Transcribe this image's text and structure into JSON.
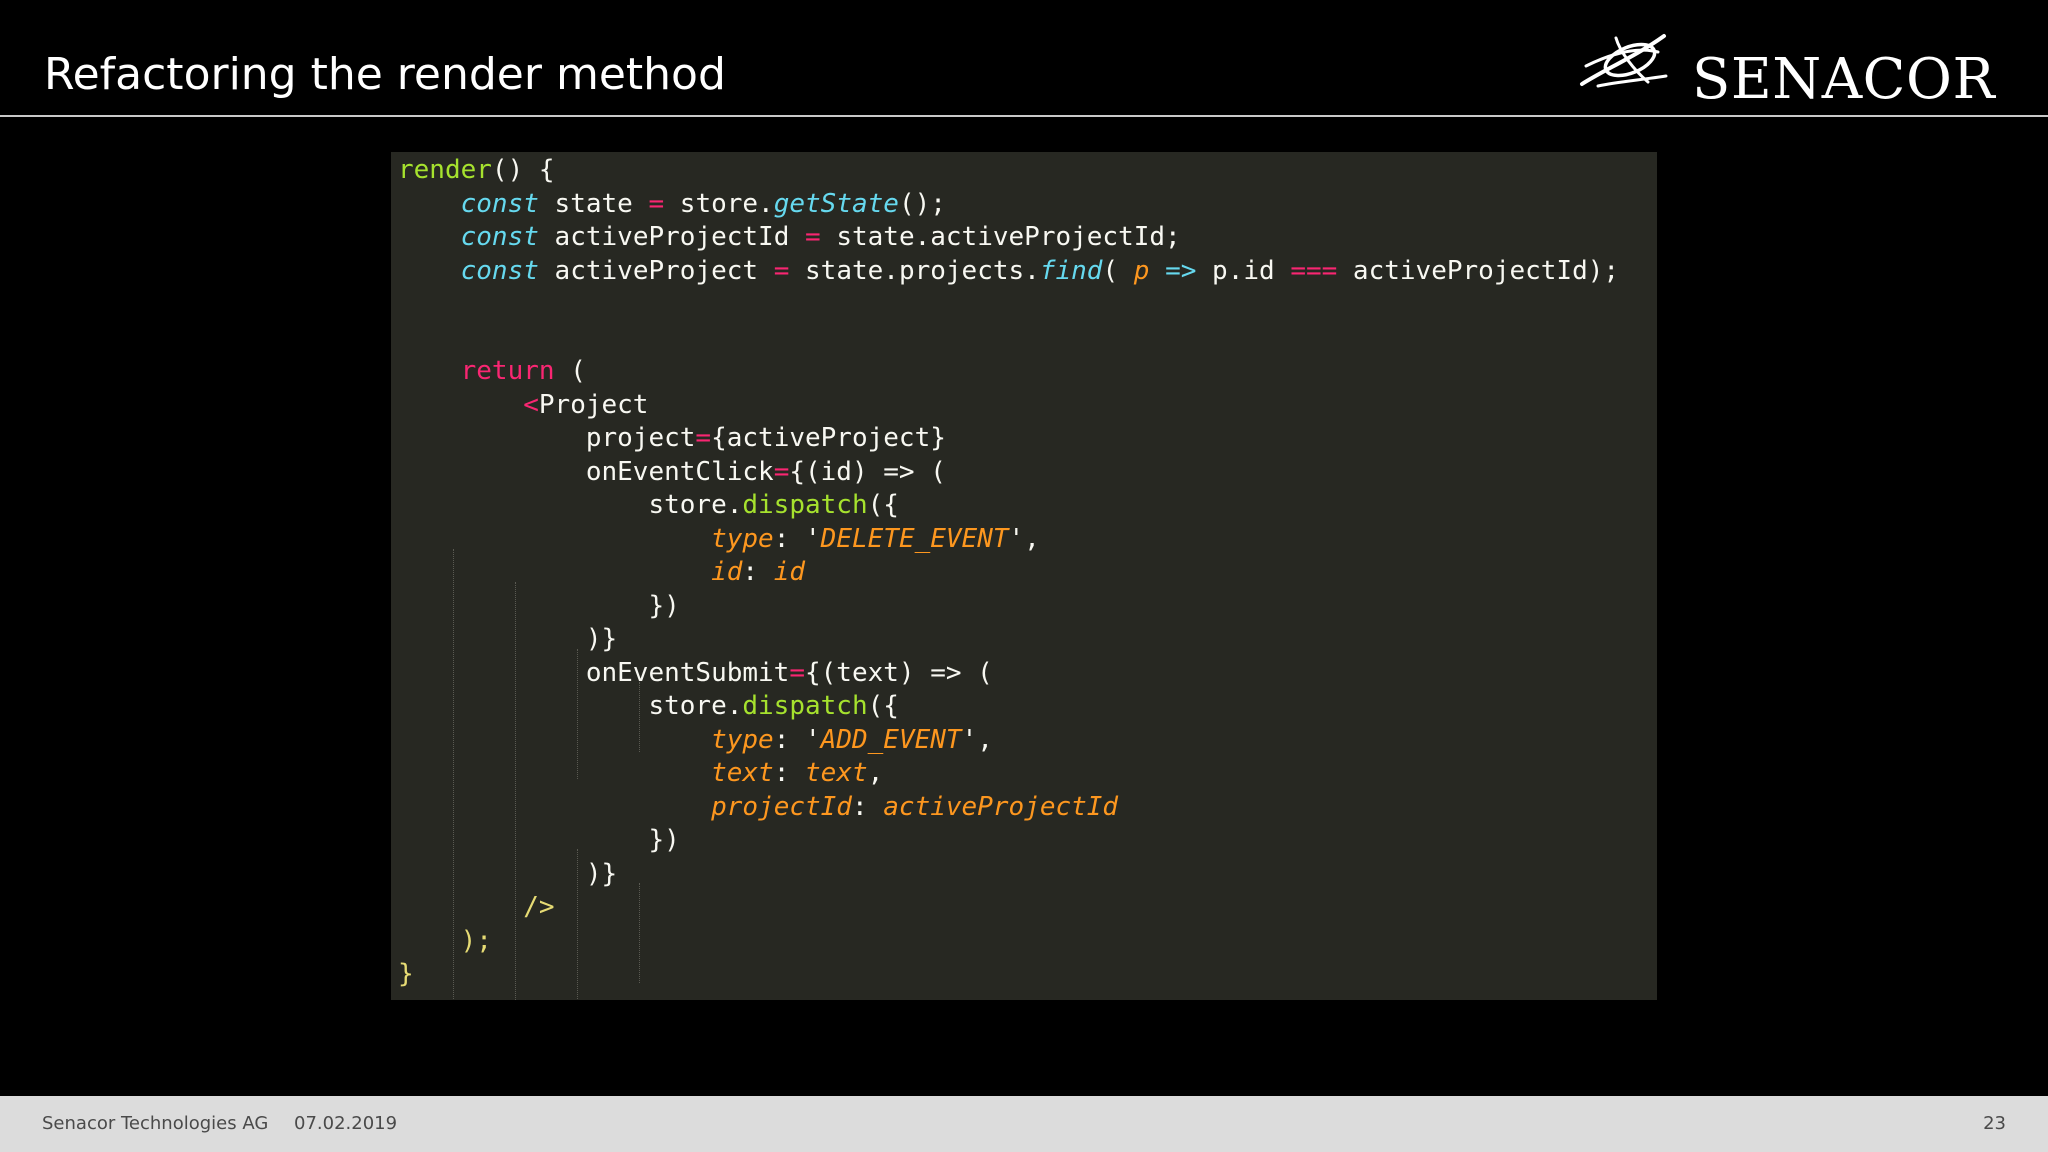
{
  "slide": {
    "title": "Refactoring the render method",
    "logo_text": "SENACOR"
  },
  "colors": {
    "background": "#000000",
    "code_background": "#272822",
    "footer_background": "#dcdcdc",
    "keyword": "#66d9ef",
    "function": "#a6e22e",
    "operator": "#f92672",
    "parameter": "#fd971f",
    "string": "#e6db74"
  },
  "icons": {
    "logo_mark": "senacor-swirl-logo-icon"
  },
  "code": {
    "lines": [
      [
        {
          "t": "render",
          "c": "fn"
        },
        {
          "t": "() {",
          "c": "txt"
        }
      ],
      [
        {
          "t": "    ",
          "c": "txt"
        },
        {
          "t": "const",
          "c": "kw"
        },
        {
          "t": " state ",
          "c": "txt"
        },
        {
          "t": "=",
          "c": "op"
        },
        {
          "t": " store.",
          "c": "txt"
        },
        {
          "t": "getState",
          "c": "kw"
        },
        {
          "t": "();",
          "c": "txt"
        }
      ],
      [
        {
          "t": "    ",
          "c": "txt"
        },
        {
          "t": "const",
          "c": "kw"
        },
        {
          "t": " activeProjectId ",
          "c": "txt"
        },
        {
          "t": "=",
          "c": "op"
        },
        {
          "t": " state.activeProjectId;",
          "c": "txt"
        }
      ],
      [
        {
          "t": "    ",
          "c": "txt"
        },
        {
          "t": "const",
          "c": "kw"
        },
        {
          "t": " activeProject ",
          "c": "txt"
        },
        {
          "t": "=",
          "c": "op"
        },
        {
          "t": " state.projects.",
          "c": "txt"
        },
        {
          "t": "find",
          "c": "kw"
        },
        {
          "t": "( ",
          "c": "txt"
        },
        {
          "t": "p",
          "c": "param"
        },
        {
          "t": " ",
          "c": "txt"
        },
        {
          "t": "=>",
          "c": "kw"
        },
        {
          "t": " p.id ",
          "c": "txt"
        },
        {
          "t": "===",
          "c": "op"
        },
        {
          "t": " activeProjectId);",
          "c": "txt"
        }
      ],
      [],
      [],
      [
        {
          "t": "    ",
          "c": "txt"
        },
        {
          "t": "return",
          "c": "ret"
        },
        {
          "t": " (",
          "c": "txt"
        }
      ],
      [
        {
          "t": "        ",
          "c": "txt"
        },
        {
          "t": "<",
          "c": "op"
        },
        {
          "t": "Project",
          "c": "txt"
        }
      ],
      [
        {
          "t": "            project",
          "c": "txt"
        },
        {
          "t": "=",
          "c": "op"
        },
        {
          "t": "{activeProject}",
          "c": "txt"
        }
      ],
      [
        {
          "t": "            onEventClick",
          "c": "txt"
        },
        {
          "t": "=",
          "c": "op"
        },
        {
          "t": "{(id) => (",
          "c": "txt"
        }
      ],
      [
        {
          "t": "                store.",
          "c": "txt"
        },
        {
          "t": "dispatch",
          "c": "fn"
        },
        {
          "t": "({",
          "c": "txt"
        }
      ],
      [
        {
          "t": "                    ",
          "c": "txt"
        },
        {
          "t": "type",
          "c": "param"
        },
        {
          "t": ": '",
          "c": "txt"
        },
        {
          "t": "DELETE_EVENT",
          "c": "param"
        },
        {
          "t": "',",
          "c": "txt"
        }
      ],
      [
        {
          "t": "                    ",
          "c": "txt"
        },
        {
          "t": "id",
          "c": "param"
        },
        {
          "t": ": ",
          "c": "txt"
        },
        {
          "t": "id",
          "c": "param"
        }
      ],
      [
        {
          "t": "                })",
          "c": "txt"
        }
      ],
      [
        {
          "t": "            )}",
          "c": "txt"
        }
      ],
      [
        {
          "t": "            onEventSubmit",
          "c": "txt"
        },
        {
          "t": "=",
          "c": "op"
        },
        {
          "t": "{(text) => (",
          "c": "txt"
        }
      ],
      [
        {
          "t": "                store.",
          "c": "txt"
        },
        {
          "t": "dispatch",
          "c": "fn"
        },
        {
          "t": "({",
          "c": "txt"
        }
      ],
      [
        {
          "t": "                    ",
          "c": "txt"
        },
        {
          "t": "type",
          "c": "param"
        },
        {
          "t": ": '",
          "c": "txt"
        },
        {
          "t": "ADD_EVENT",
          "c": "param"
        },
        {
          "t": "',",
          "c": "txt"
        }
      ],
      [
        {
          "t": "                    ",
          "c": "txt"
        },
        {
          "t": "text",
          "c": "param"
        },
        {
          "t": ": ",
          "c": "txt"
        },
        {
          "t": "text",
          "c": "param"
        },
        {
          "t": ",",
          "c": "txt"
        }
      ],
      [
        {
          "t": "                    ",
          "c": "txt"
        },
        {
          "t": "projectId",
          "c": "param"
        },
        {
          "t": ": ",
          "c": "txt"
        },
        {
          "t": "activeProjectId",
          "c": "param"
        }
      ],
      [
        {
          "t": "                })",
          "c": "txt"
        }
      ],
      [
        {
          "t": "            )}",
          "c": "txt"
        }
      ],
      [
        {
          "t": "        ",
          "c": "txt"
        },
        {
          "t": "/>",
          "c": "brace"
        }
      ],
      [
        {
          "t": "    ",
          "c": "txt"
        },
        {
          "t": ");",
          "c": "brace"
        }
      ],
      [
        {
          "t": "}",
          "c": "brace"
        }
      ]
    ]
  },
  "footer": {
    "company": "Senacor Technologies AG",
    "date": "07.02.2019",
    "page": "23"
  }
}
